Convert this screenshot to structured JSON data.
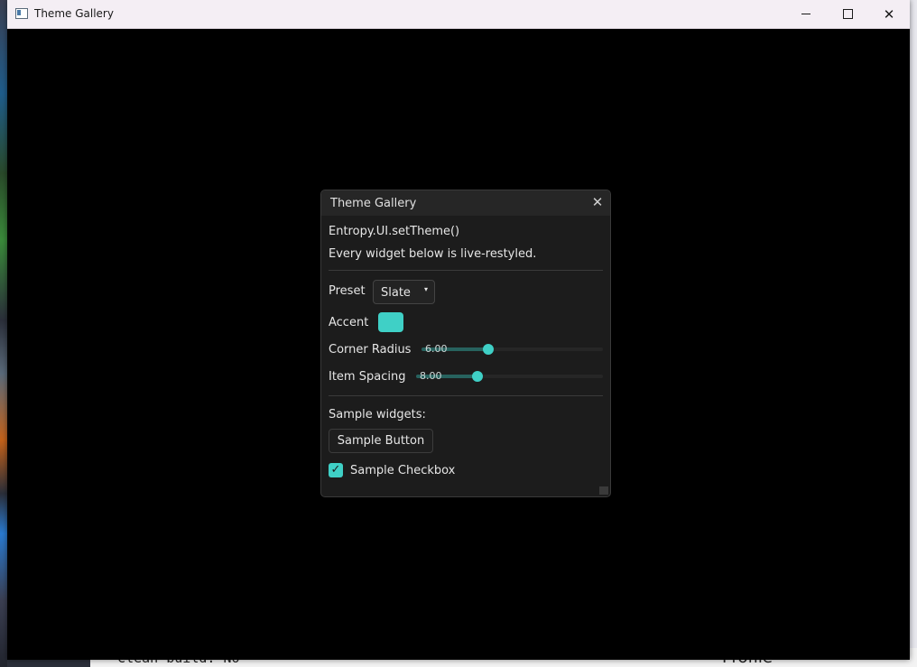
{
  "window": {
    "title": "Theme Gallery",
    "minimize": "–",
    "maximize": "□",
    "close": "✕"
  },
  "background_app": {
    "bullet_text": "• Clean build: No",
    "right_text": "Profile"
  },
  "dialog": {
    "title": "Theme Gallery",
    "close_glyph": "✕",
    "heading": "Entropy.UI.setTheme()",
    "description": "Every widget below is live-restyled.",
    "preset": {
      "label": "Preset",
      "value": "Slate",
      "arrow": "▾"
    },
    "accent": {
      "label": "Accent",
      "color": "#3fd0c6"
    },
    "corner_radius": {
      "label": "Corner Radius",
      "value_text": "6.00",
      "fraction": 0.37
    },
    "item_spacing": {
      "label": "Item Spacing",
      "value_text": "8.00",
      "fraction": 0.33
    },
    "samples_heading": "Sample widgets:",
    "sample_button": "Sample Button",
    "sample_checkbox": {
      "label": "Sample Checkbox",
      "checked": true,
      "glyph": "✓"
    }
  }
}
